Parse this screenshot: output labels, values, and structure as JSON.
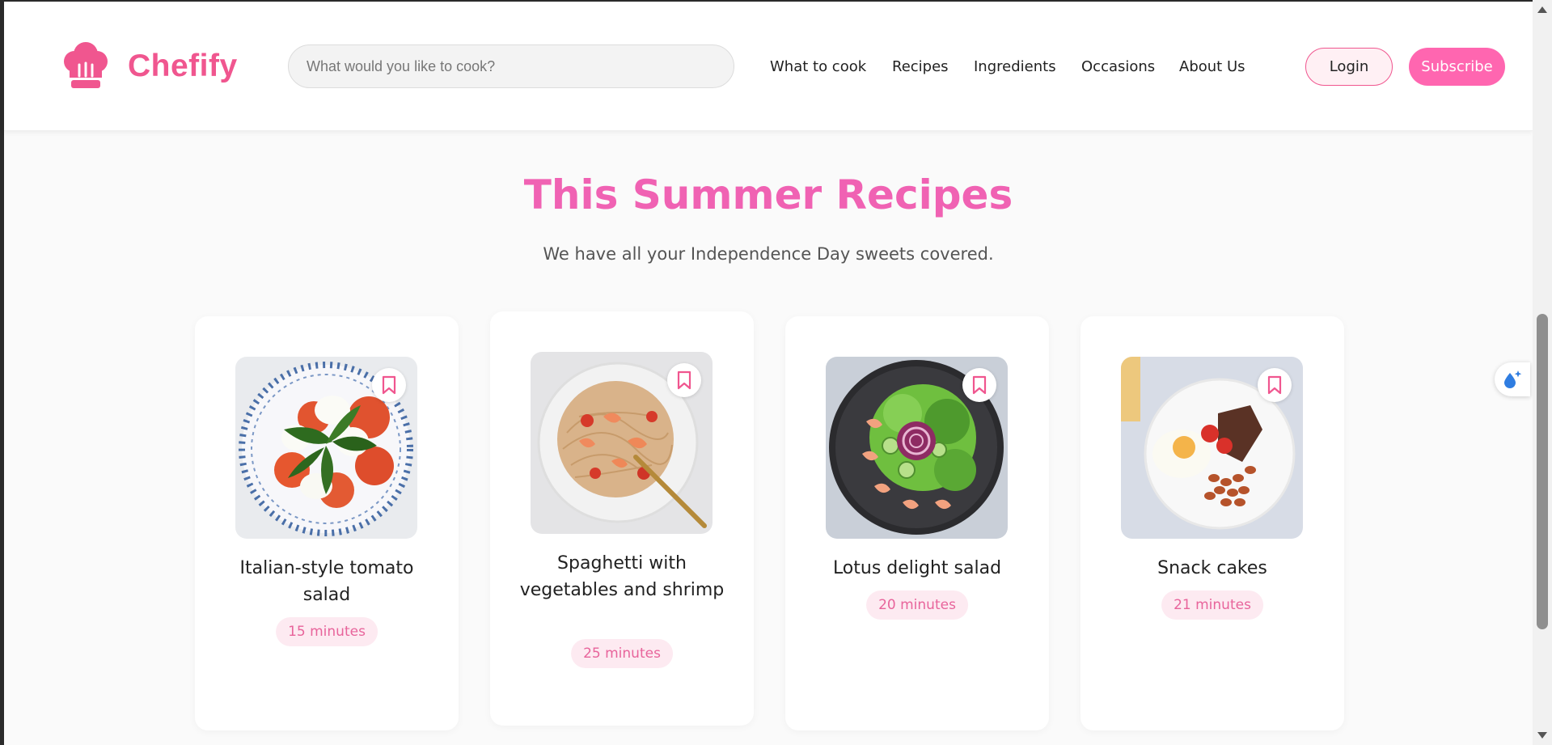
{
  "brand": {
    "name": "Chefify",
    "accent": "#f0568f",
    "pink": "#ff66b0"
  },
  "search": {
    "placeholder": "What would you like to cook?",
    "value": ""
  },
  "nav": [
    {
      "label": "What to cook"
    },
    {
      "label": "Recipes"
    },
    {
      "label": "Ingredients"
    },
    {
      "label": "Occasions"
    },
    {
      "label": "About Us"
    }
  ],
  "auth": {
    "login_label": "Login",
    "subscribe_label": "Subscribe"
  },
  "section": {
    "title": "This Summer Recipes",
    "subtitle": "We have all your Independence Day sweets covered."
  },
  "recipes": [
    {
      "title": "Italian-style tomato salad",
      "time": "15 minutes",
      "image": "tomato-mozzarella-salad",
      "saved": false
    },
    {
      "title": "Spaghetti with vegetables and shrimp",
      "time": "25 minutes",
      "image": "spaghetti-shrimp",
      "saved": false
    },
    {
      "title": "Lotus delight salad",
      "time": "20 minutes",
      "image": "shrimp-cucumber-salad",
      "saved": false
    },
    {
      "title": "Snack cakes",
      "time": "21 minutes",
      "image": "breakfast-plate",
      "saved": false
    }
  ],
  "icons": {
    "logo": "chef-hat-icon",
    "bookmark": "bookmark-icon",
    "extension": "water-drop-sparkle-icon"
  }
}
